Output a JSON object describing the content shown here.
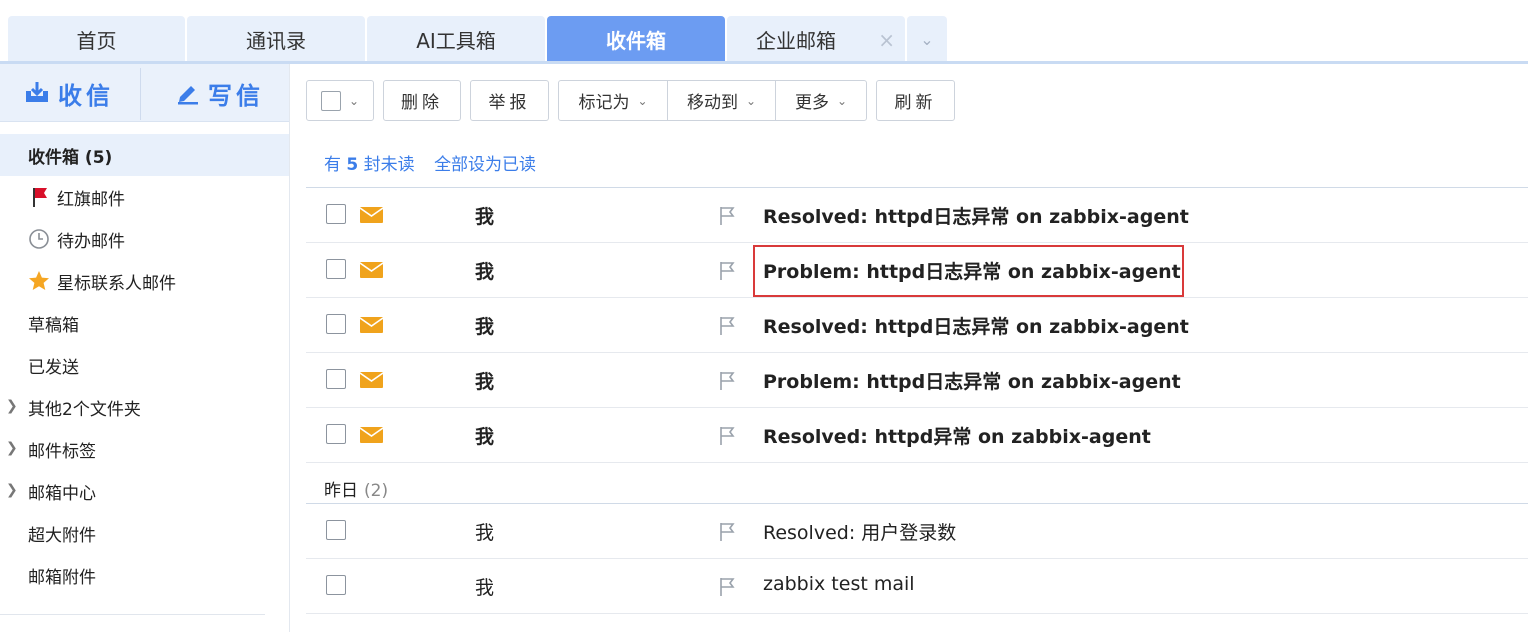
{
  "tabs": [
    {
      "label": "首页",
      "active": false
    },
    {
      "label": "通讯录",
      "active": false
    },
    {
      "label": "AI工具箱",
      "active": false
    },
    {
      "label": "收件箱",
      "active": true
    },
    {
      "label": "企业邮箱",
      "active": false,
      "closable": true
    }
  ],
  "tab_close_glyph": "×",
  "tab_more_glyph": "⌄",
  "compose": {
    "receive_label": "收信",
    "write_label": "写信"
  },
  "folders": [
    {
      "label": "收件箱 (5)",
      "active": true
    },
    {
      "label": "红旗邮件",
      "icon": "red-flag-icon"
    },
    {
      "label": "待办邮件",
      "icon": "clock-icon"
    },
    {
      "label": "星标联系人邮件",
      "icon": "star-icon"
    },
    {
      "label": "草稿箱"
    },
    {
      "label": "已发送"
    },
    {
      "label": "其他2个文件夹",
      "expandable": true
    },
    {
      "label": "邮件标签",
      "expandable": true
    },
    {
      "label": "邮箱中心",
      "expandable": true
    },
    {
      "label": "超大附件"
    },
    {
      "label": "邮箱附件"
    }
  ],
  "toolbar": {
    "delete": "删除",
    "report": "举报",
    "mark_as": "标记为",
    "move_to": "移动到",
    "more": "更多",
    "refresh": "刷新"
  },
  "unread": {
    "prefix": "有",
    "count": "5",
    "suffix": "封未读",
    "mark_all_read": "全部设为已读"
  },
  "today_mails": [
    {
      "sender": "我",
      "subject": "Resolved: httpd日志异常 on zabbix-agent",
      "unread": true
    },
    {
      "sender": "我",
      "subject": "Problem: httpd日志异常 on zabbix-agent",
      "unread": true,
      "highlighted": true
    },
    {
      "sender": "我",
      "subject": "Resolved: httpd日志异常 on zabbix-agent",
      "unread": true
    },
    {
      "sender": "我",
      "subject": "Problem: httpd日志异常 on zabbix-agent",
      "unread": true
    },
    {
      "sender": "我",
      "subject": "Resolved: httpd异常 on zabbix-agent",
      "unread": true
    }
  ],
  "yesterday_group": {
    "label": "昨日",
    "count": "(2)"
  },
  "yesterday_mails": [
    {
      "sender": "我",
      "subject": "Resolved: 用户登录数",
      "unread": false
    },
    {
      "sender": "我",
      "subject": "zabbix test mail",
      "unread": false
    }
  ],
  "colors": {
    "accent": "#3b7de9",
    "active_tab": "#6c9cf2",
    "envelope": "#f0a31c",
    "highlight_border": "#d93a3a"
  }
}
